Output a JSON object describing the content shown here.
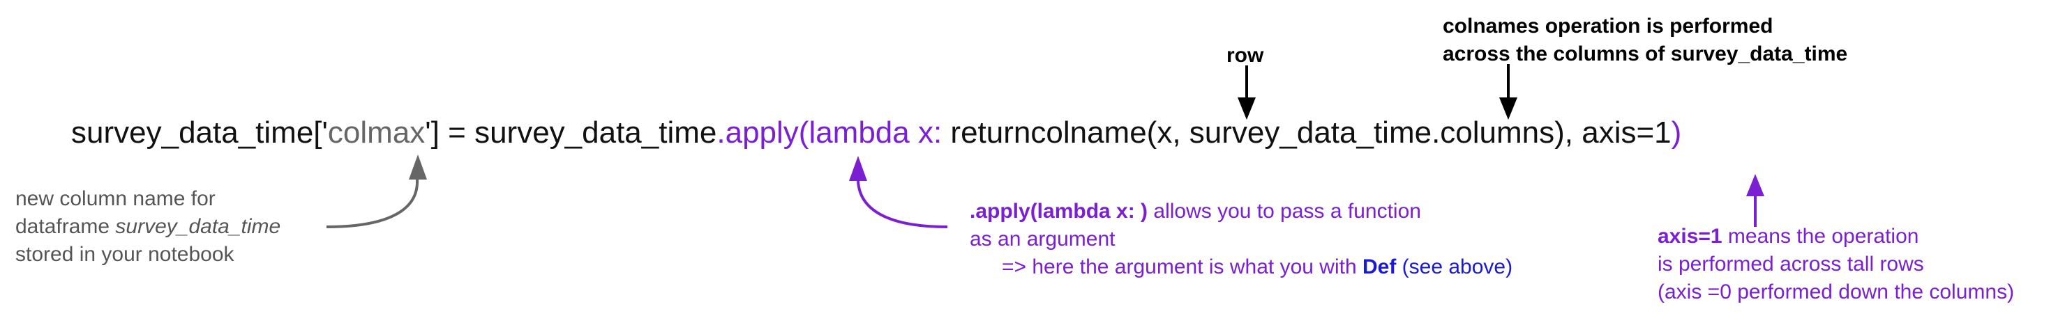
{
  "code_line": {
    "part1": "survey_data_time['",
    "colmax": "colmax",
    "part2": "'] = survey_data_time",
    "apply": ".apply(lambda x:",
    "part3": " returncolname(x, survey_data_time.columns), axis=1",
    "close": ")"
  },
  "labels": {
    "row": "row",
    "colnames_line1": "colnames  operation is performed",
    "colnames_line2": "across the columns of survey_data_time"
  },
  "notes": {
    "new_column": {
      "line1": "new column name for",
      "line2_prefix": "dataframe ",
      "line2_italic": "survey_data_time",
      "line3": "stored in your notebook"
    },
    "apply": {
      "line1_bold": ".apply(lambda x: )",
      "line1_rest": " allows you to pass a function",
      "line2": "as an argument",
      "line3_prefix": "=> here the argument is what you with ",
      "line3_def": "Def",
      "line3_paren": "(see above)"
    },
    "axis": {
      "line1_bold": "axis=1",
      "line1_rest": " means the operation",
      "line2": "is performed across tall rows",
      "line3": "(axis =0 performed down the columns)"
    }
  },
  "colors": {
    "purple": "#7a1fd1",
    "grey": "#666666",
    "black": "#000000",
    "blue": "#1a1ad6"
  }
}
